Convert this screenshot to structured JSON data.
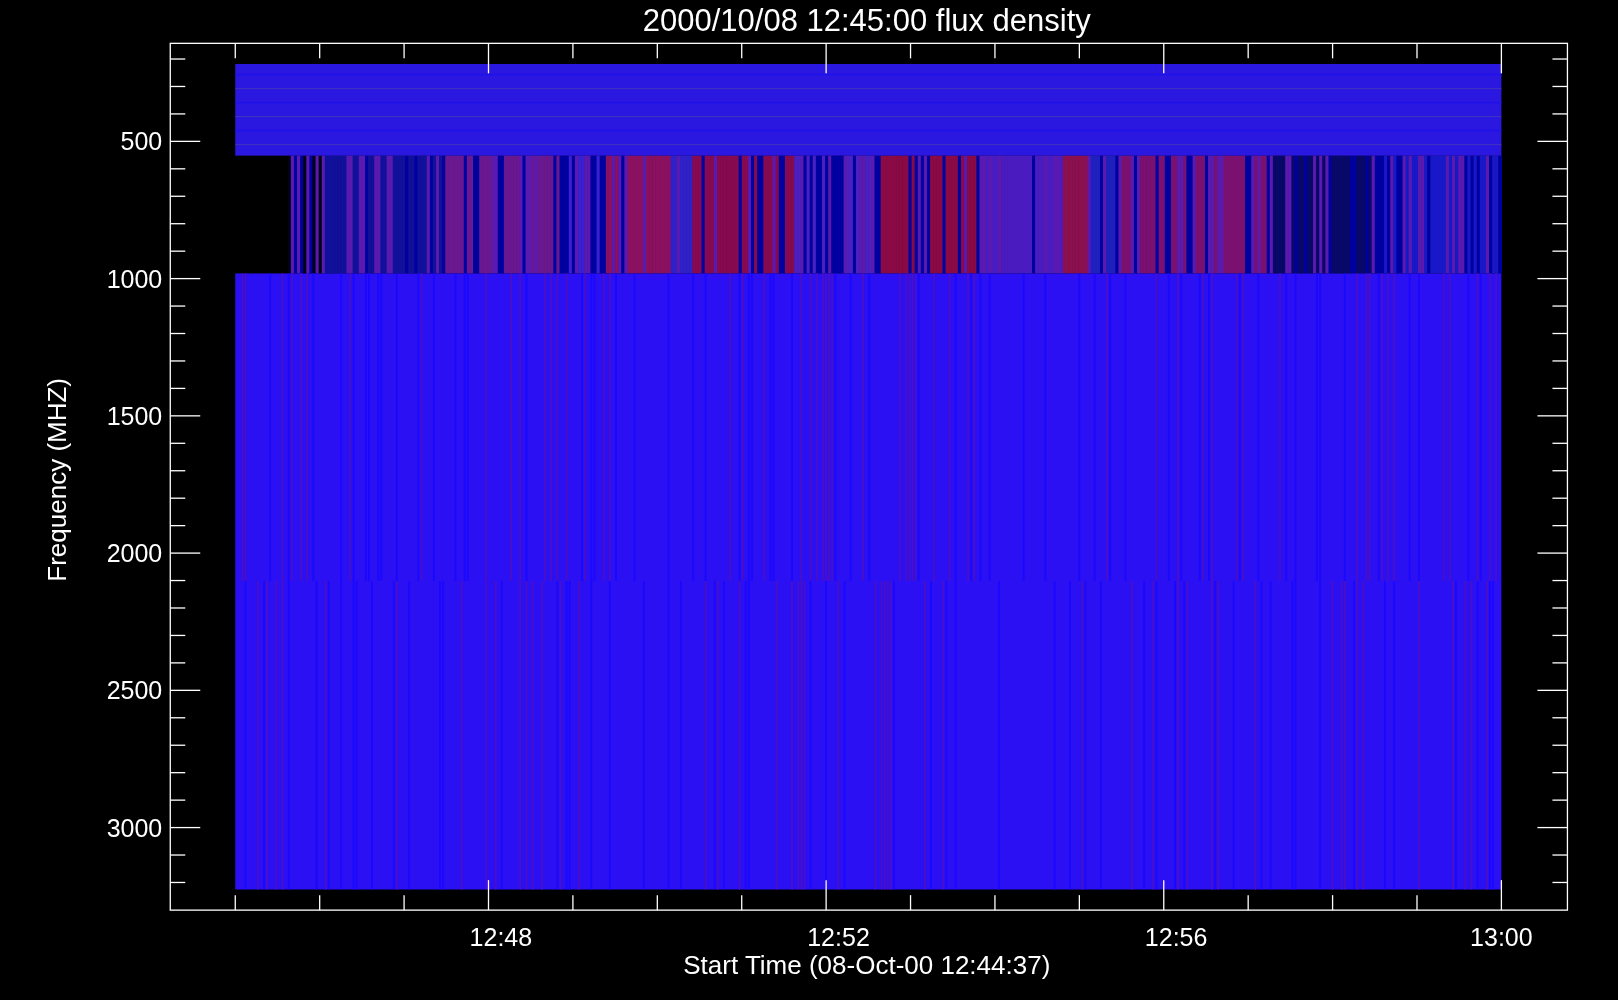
{
  "title": "2000/10/08 12:45:00 flux density",
  "y_axis": {
    "label": "Frequency (MHZ)",
    "ticks": [
      "500",
      "1000",
      "1500",
      "2000",
      "2500",
      "3000"
    ]
  },
  "x_axis": {
    "label": "Start Time (08-Oct-00 12:44:37)",
    "ticks": [
      "12:48",
      "12:52",
      "12:56",
      "13:00"
    ]
  }
}
